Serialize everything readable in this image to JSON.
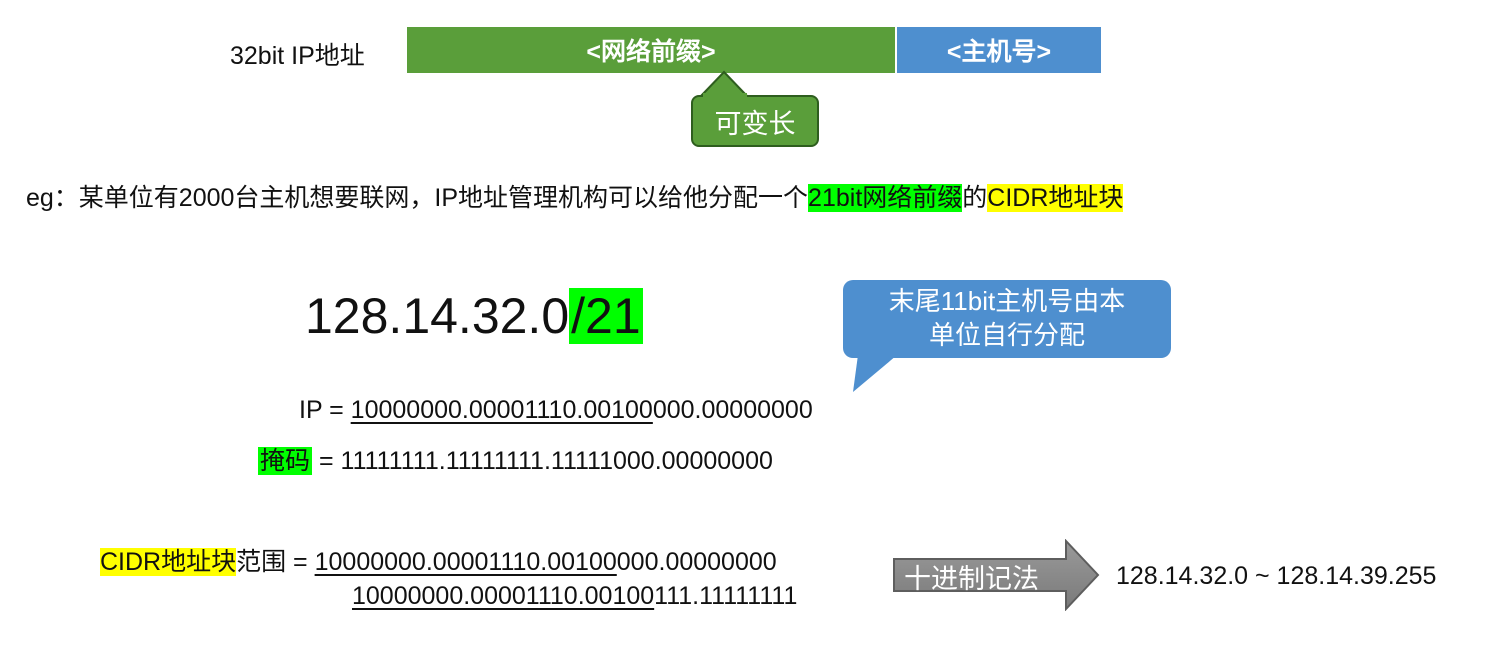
{
  "top_bar": {
    "label": "32bit IP地址",
    "prefix_text": "<网络前缀>",
    "host_text": "<主机号>",
    "variable_callout": "可变长",
    "prefix_color": "#5a9e3a",
    "host_color": "#4e8fcf"
  },
  "example": {
    "prefix": "eg：某单位有2000台主机想要联网，IP地址管理机构可以给他分配一个",
    "highlight_green": "21bit网络前缀",
    "middle": "的",
    "highlight_yellow": "CIDR地址块"
  },
  "cidr": {
    "base": "128.14.32.0",
    "suffix": "/21",
    "callout_line1": "末尾11bit主机号由本",
    "callout_line2": "单位自行分配"
  },
  "ip_row": {
    "label": "IP = ",
    "underlined": "10000000.00001110.00100",
    "rest": "000.00000000"
  },
  "mask_row": {
    "label": "掩码",
    "equals": " = ",
    "value": "11111111.11111111.11111000.00000000"
  },
  "range": {
    "label_highlight": "CIDR地址块",
    "label_rest": "范围 = ",
    "low_underlined": "10000000.00001110.00100",
    "low_rest": "000.00000000",
    "high_underlined": "10000000.00001110.00100",
    "high_rest": "111.11111111",
    "arrow_text": "十进制记法",
    "decimal": "128.14.32.0 ~ 128.14.39.255"
  }
}
